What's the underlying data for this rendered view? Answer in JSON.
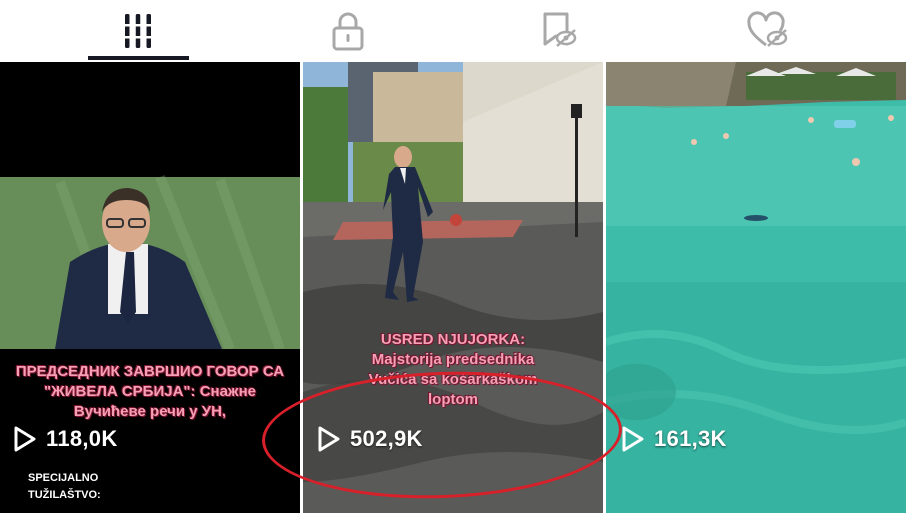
{
  "tabs": [
    {
      "icon": "grid-icon",
      "selected": true
    },
    {
      "icon": "lock-icon",
      "selected": false
    },
    {
      "icon": "bookmark-hidden-icon",
      "selected": false
    },
    {
      "icon": "heart-hidden-icon",
      "selected": false
    }
  ],
  "videos": [
    {
      "views": "118,0K",
      "caption": "ПРЕДСЕДНИК ЗАВРШИО ГОВОР СА \"ЖИВЕЛА СРБИЈА\": Снажне Вучићеве речи у УН,",
      "subcaption_line1": "SPECIJALNO",
      "subcaption_line2": "TUŽILAŠTVO:"
    },
    {
      "views": "502,9K",
      "caption_line1": "USRED NJUJORKA:",
      "caption_line2": "Majstorija predsednika",
      "caption_line3": "Vučića sa košarkaškom",
      "caption_line4": "loptom"
    },
    {
      "views": "161,3K"
    }
  ],
  "colors": {
    "highlight_ring": "#d8202a",
    "caption_pink": "#f5a0b4",
    "tab_active": "#161823",
    "tab_inactive": "#a8a8a8"
  }
}
